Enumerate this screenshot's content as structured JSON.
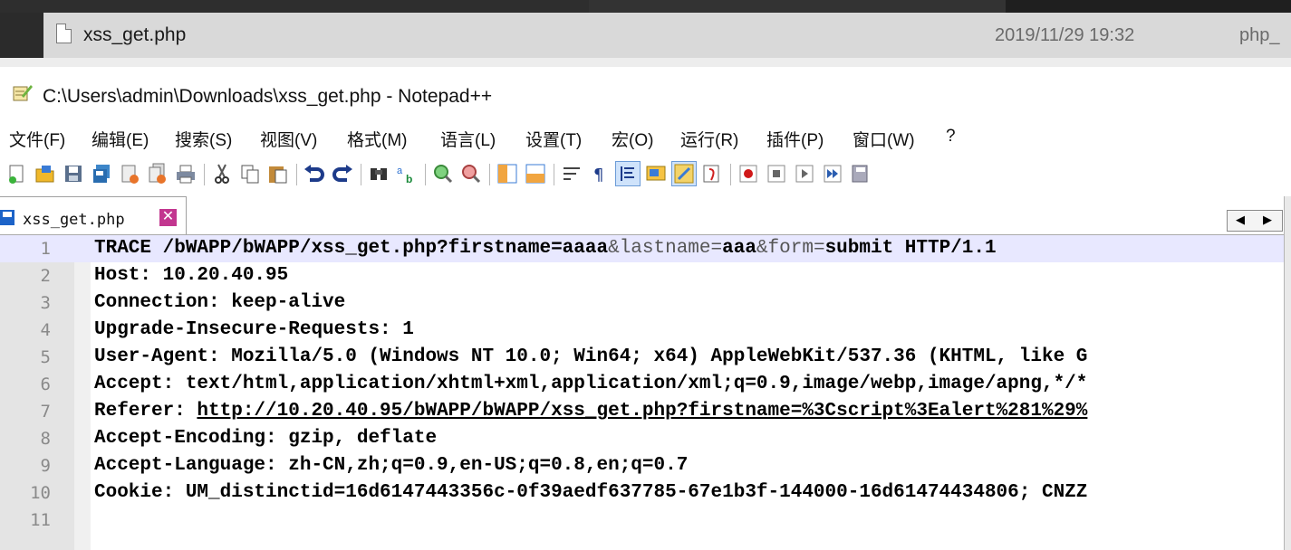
{
  "explorer": {
    "file_name": "xss_get.php",
    "modified": "2019/11/29 19:32",
    "type_partial": "php_"
  },
  "window": {
    "title": "C:\\Users\\admin\\Downloads\\xss_get.php - Notepad++"
  },
  "menu": [
    "文件(F)",
    "编辑(E)",
    "搜索(S)",
    "视图(V)",
    "格式(M)",
    "语言(L)",
    "设置(T)",
    "宏(O)",
    "运行(R)",
    "插件(P)",
    "窗口(W)",
    "?"
  ],
  "tab": {
    "label": "xss_get.php",
    "close_glyph": "✕"
  },
  "nav_arrows": {
    "left": "◀",
    "right": "▶"
  },
  "editor": {
    "lines": [
      {
        "num": "1",
        "parts": [
          [
            "b",
            "TRACE /bWAPP/bWAPP/xss_get.php?firstname=aaaa"
          ],
          [
            "n",
            "&lastname="
          ],
          [
            "b",
            "aaa"
          ],
          [
            "n",
            "&form="
          ],
          [
            "b",
            "submit HTTP/1.1"
          ]
        ]
      },
      {
        "num": "2",
        "parts": [
          [
            "b",
            "Host: 10.20.40.95"
          ]
        ]
      },
      {
        "num": "3",
        "parts": [
          [
            "b",
            "Connection: keep-alive"
          ]
        ]
      },
      {
        "num": "4",
        "parts": [
          [
            "b",
            "Upgrade-Insecure-Requests: 1"
          ]
        ]
      },
      {
        "num": "5",
        "parts": [
          [
            "b",
            "User-Agent: Mozilla/5.0 (Windows NT 10.0; Win64; x64) AppleWebKit/537.36 (KHTML, like G"
          ]
        ]
      },
      {
        "num": "6",
        "parts": [
          [
            "b",
            "Accept: text/html,application/xhtml+xml,application/xml;q=0.9,image/webp,image/apng,*/*"
          ]
        ]
      },
      {
        "num": "7",
        "parts": [
          [
            "b",
            "Referer: "
          ],
          [
            "u",
            "http://10.20.40.95/bWAPP/bWAPP/xss_get.php?firstname=%3Cscript%3Ealert%281%29%"
          ]
        ]
      },
      {
        "num": "8",
        "parts": [
          [
            "b",
            "Accept-Encoding: gzip, deflate"
          ]
        ]
      },
      {
        "num": "9",
        "parts": [
          [
            "b",
            "Accept-Language: zh-CN,zh;q=0.9,en-US;q=0.8,en;q=0.7"
          ]
        ]
      },
      {
        "num": "10",
        "parts": [
          [
            "b",
            "Cookie: UM_distinctid=16d6147443356c-0f39aedf637785-67e1b3f-144000-16d61474434806; CNZZ"
          ]
        ]
      },
      {
        "num": "11",
        "parts": []
      }
    ]
  },
  "colors": {
    "current_line": "#e8e8ff",
    "gutter": "#e4e4e4",
    "tab_close": "#c2368f"
  },
  "toolbar_icons": [
    "new-file-icon",
    "open-file-icon",
    "save-icon",
    "save-all-icon",
    "close-icon",
    "close-all-icon",
    "print-icon",
    "cut-icon",
    "copy-icon",
    "paste-icon",
    "undo-icon",
    "redo-icon",
    "find-icon",
    "replace-icon",
    "zoom-in-icon",
    "zoom-out-icon",
    "sync-vertical-icon",
    "sync-horizontal-icon",
    "word-wrap-icon",
    "show-all-chars-icon",
    "indent-guide-icon",
    "doc-map-icon",
    "function-list-icon",
    "folder-workspace-icon",
    "record-macro-icon",
    "stop-macro-icon",
    "play-macro-icon",
    "run-macro-multiple-icon",
    "save-macro-icon"
  ]
}
